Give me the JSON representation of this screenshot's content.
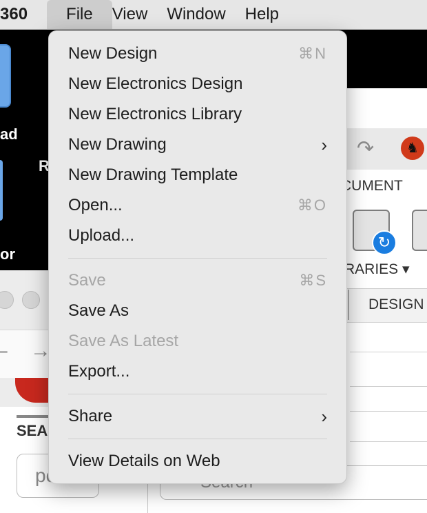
{
  "menubar": {
    "app": "360",
    "items": [
      {
        "label": "File"
      },
      {
        "label": "View"
      },
      {
        "label": "Window"
      },
      {
        "label": "Help"
      }
    ]
  },
  "background": {
    "desk_label_a": "ad",
    "desk_label_b": "R",
    "desk_label_c": "or",
    "left_search_label": "SEA",
    "left_input_value": "pc",
    "document_label": "CUMENT",
    "libraries_label": "RARIES ▾",
    "design_tab": "DESIGN",
    "right_search_placeholder": "Search"
  },
  "file_menu": {
    "group1": [
      {
        "label": "New Design",
        "shortcut": "⌘N"
      },
      {
        "label": "New Electronics Design",
        "shortcut": ""
      },
      {
        "label": "New Electronics Library",
        "shortcut": ""
      },
      {
        "label": "New Drawing",
        "shortcut": ""
      },
      {
        "label": "New Drawing Template",
        "shortcut": ""
      },
      {
        "label": "Open...",
        "shortcut": "⌘O"
      },
      {
        "label": "Upload...",
        "shortcut": ""
      }
    ],
    "group2": [
      {
        "label": "Save",
        "shortcut": "⌘S"
      },
      {
        "label": "Save As",
        "shortcut": ""
      },
      {
        "label": "Save As Latest",
        "shortcut": ""
      },
      {
        "label": "Export...",
        "shortcut": ""
      }
    ],
    "group3": [
      {
        "label": "Share",
        "shortcut": ""
      }
    ],
    "group4": [
      {
        "label": "View Details on Web",
        "shortcut": ""
      }
    ]
  },
  "icons": {
    "submenu": "chevron-right-icon",
    "refresh": "refresh-icon",
    "redo": "redo-icon",
    "logo": "app-logo-icon"
  }
}
